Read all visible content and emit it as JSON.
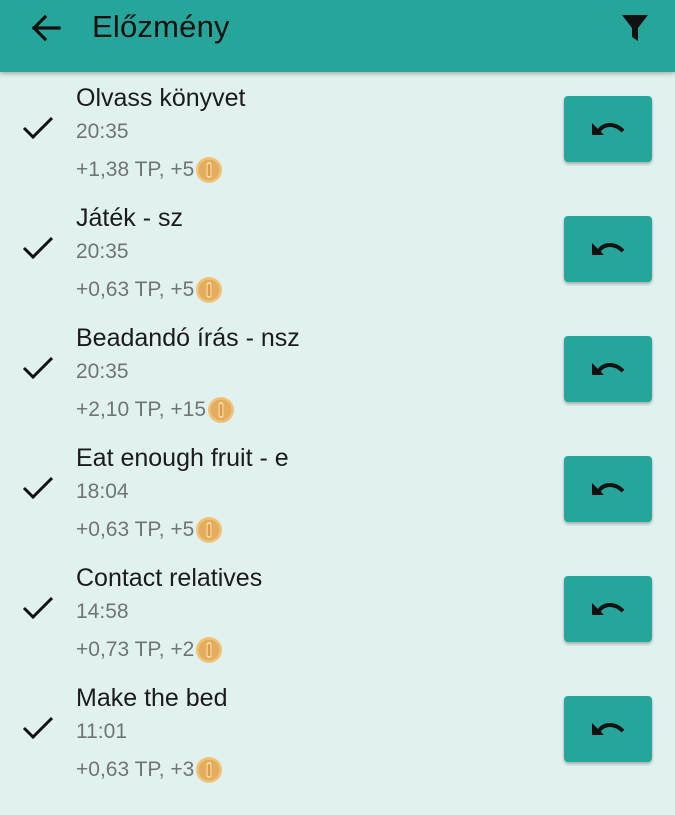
{
  "appbar": {
    "title": "Előzmény",
    "back_icon": "arrow-left-icon",
    "filter_icon": "filter-icon",
    "background": "#26a69a"
  },
  "history": [
    {
      "title": "Olvass könyvet",
      "time": "20:35",
      "reward": "+1,38 TP, +5"
    },
    {
      "title": "Játék - sz",
      "time": "20:35",
      "reward": "+0,63 TP, +5"
    },
    {
      "title": "Beadandó írás - nsz",
      "time": "20:35",
      "reward": "+2,10 TP, +15"
    },
    {
      "title": "Eat enough fruit - e",
      "time": "18:04",
      "reward": "+0,63 TP, +5"
    },
    {
      "title": "Contact relatives",
      "time": "14:58",
      "reward": "+0,73 TP, +2"
    },
    {
      "title": "Make the bed",
      "time": "11:01",
      "reward": "+0,63 TP, +3"
    }
  ],
  "icons": {
    "check": "check-icon",
    "coin": "coin-icon",
    "undo": "undo-icon"
  },
  "colors": {
    "accent": "#26a69a",
    "background": "#e0f1ef",
    "coin": "#e9b96a"
  }
}
